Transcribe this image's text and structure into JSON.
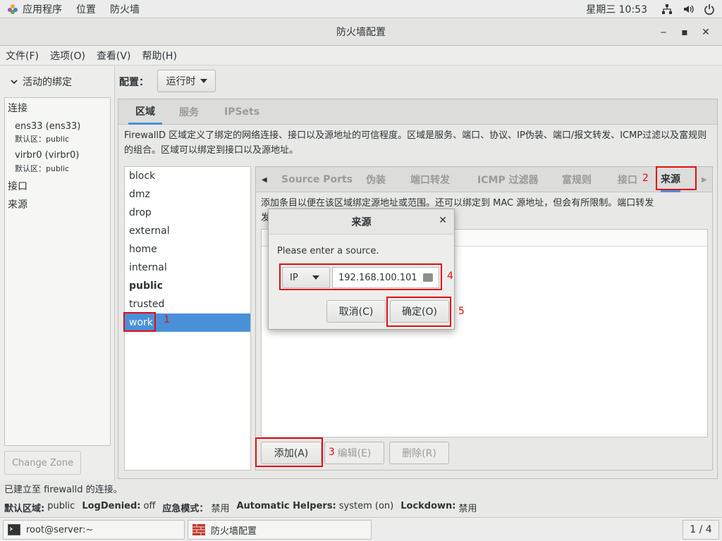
{
  "topbar": {
    "apps": "应用程序",
    "places": "位置",
    "firewall": "防火墙",
    "clock": "星期三 10:53"
  },
  "window": {
    "title": "防火墙配置",
    "minimize": "‒",
    "maximize": "▪",
    "close": "✕"
  },
  "menus": [
    "文件(F)",
    "选项(O)",
    "查看(V)",
    "帮助(H)"
  ],
  "sidebar": {
    "expander": "活动的绑定",
    "connections_header": "连接",
    "connections": [
      {
        "name": "ens33 (ens33)",
        "zone": "默认区：public"
      },
      {
        "name": "virbr0 (virbr0)",
        "zone": "默认区：public"
      }
    ],
    "interfaces_header": "接口",
    "sources_header": "来源",
    "change_zone": "Change Zone"
  },
  "config": {
    "label": "配置：",
    "value": "运行时"
  },
  "main_tabs": [
    "区域",
    "服务",
    "IPSets"
  ],
  "zone_description": "FirewallD 区域定义了绑定的网络连接、接口以及源地址的可信程度。区域是服务、端口、协议、IP伪装、端口/报文转发、ICMP过滤以及富规则的组合。区域可以绑定到接口以及源地址。",
  "zones": [
    "block",
    "dmz",
    "drop",
    "external",
    "home",
    "internal",
    "public",
    "trusted",
    "work"
  ],
  "inner_tabs": [
    "Source Ports",
    "伪装",
    "端口转发",
    "ICMP 过滤器",
    "富规则",
    "接口",
    "来源"
  ],
  "source_description": "添加条目以便在该区域绑定源地址或范围。还可以绑定到 MAC 源地址，但会有所限制。端口转发",
  "source_description_line2": "发",
  "buttons": {
    "add": "添加(A)",
    "edit": "编辑(E)",
    "remove": "删除(R)"
  },
  "dialog": {
    "title": "来源",
    "close": "✕",
    "prompt": "Please enter a source.",
    "type": "IP",
    "value": "192.168.100.101",
    "cancel": "取消(C)",
    "ok": "确定(O)"
  },
  "annotations": [
    "1",
    "2",
    "3",
    "4",
    "5"
  ],
  "status": {
    "line1": "已建立至  firewalld 的连接。",
    "default_zone_label": "默认区域:",
    "default_zone_value": "public",
    "logdenied_label": "LogDenied:",
    "logdenied_value": "off",
    "panic_label": "应急模式：",
    "panic_value": "禁用",
    "helpers_label": "Automatic Helpers:",
    "helpers_value": "system (on)",
    "lockdown_label": "Lockdown:",
    "lockdown_value": "禁用"
  },
  "taskbar": {
    "terminal": "root@server:~",
    "firewall": "防火墙配置",
    "pager": "1 / 4"
  },
  "colors": {
    "accent": "#4a90d9",
    "annotation": "#e30d0d"
  }
}
